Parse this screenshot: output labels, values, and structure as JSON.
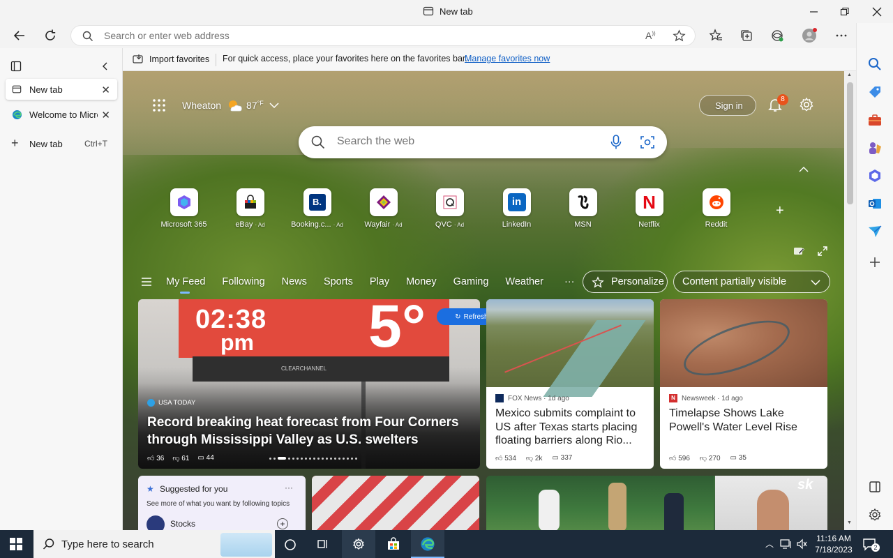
{
  "window": {
    "title": "New tab"
  },
  "toolbar": {
    "address_placeholder": "Search or enter web address"
  },
  "tabs_panel": {
    "tabs": [
      {
        "label": "New tab",
        "active": true
      },
      {
        "label": "Welcome to Microsoft Edge",
        "active": false
      }
    ],
    "new_tab_label": "New tab",
    "new_tab_shortcut": "Ctrl+T"
  },
  "favorites_bar": {
    "import_label": "Import favorites",
    "message": "For quick access, place your favorites here on the favorites bar.",
    "manage_link": "Manage favorites now"
  },
  "ntp": {
    "location": "Wheaton",
    "temperature": "87",
    "temp_unit": "°F",
    "sign_in_label": "Sign in",
    "notification_count": "8",
    "search_placeholder": "Search the web",
    "tiles": [
      {
        "label": "Microsoft 365",
        "ad": "",
        "icon": "microsoft-365-icon"
      },
      {
        "label": "eBay",
        "ad": "· Ad",
        "icon": "ebay-icon"
      },
      {
        "label": "Booking.c...",
        "ad": "· Ad",
        "icon": "booking-icon"
      },
      {
        "label": "Wayfair",
        "ad": "· Ad",
        "icon": "wayfair-icon"
      },
      {
        "label": "QVC",
        "ad": "· Ad",
        "icon": "qvc-icon"
      },
      {
        "label": "LinkedIn",
        "ad": "",
        "icon": "linkedin-icon"
      },
      {
        "label": "MSN",
        "ad": "",
        "icon": "msn-icon"
      },
      {
        "label": "Netflix",
        "ad": "",
        "icon": "netflix-icon"
      },
      {
        "label": "Reddit",
        "ad": "",
        "icon": "reddit-icon"
      }
    ],
    "feed_nav": [
      "My Feed",
      "Following",
      "News",
      "Sports",
      "Play",
      "Money",
      "Gaming",
      "Weather"
    ],
    "personalize_label": "Personalize",
    "content_visibility": "Content partially visible",
    "refresh_label": "Refresh stories"
  },
  "cards": {
    "hero": {
      "source": "USA TODAY",
      "headline": "Record breaking heat forecast from Four Corners through Mississippi Valley as U.S. swelters",
      "likes": "36",
      "dislikes": "61",
      "comments": "44",
      "clock_text": "02:38",
      "clock_sub": "pm",
      "billboard_num": "5°",
      "billboard_brand": "CLEARCHANNEL"
    },
    "card2": {
      "source": "FOX News · 1d ago",
      "headline": "Mexico submits complaint to US after Texas starts placing floating barriers along Rio...",
      "likes": "534",
      "dislikes": "2k",
      "comments": "337"
    },
    "card3": {
      "source": "Newsweek · 1d ago",
      "headline": "Timelapse Shows Lake Powell's Water Level Rise",
      "likes": "596",
      "dislikes": "270",
      "comments": "35"
    },
    "suggested": {
      "title": "Suggested for you",
      "subtitle": "See more of what you want by following topics",
      "topic": "Stocks"
    },
    "sk_badge": "sk"
  },
  "taskbar": {
    "search_placeholder": "Type here to search",
    "time": "11:16 AM",
    "date": "7/18/2023",
    "notification_count": "2"
  }
}
